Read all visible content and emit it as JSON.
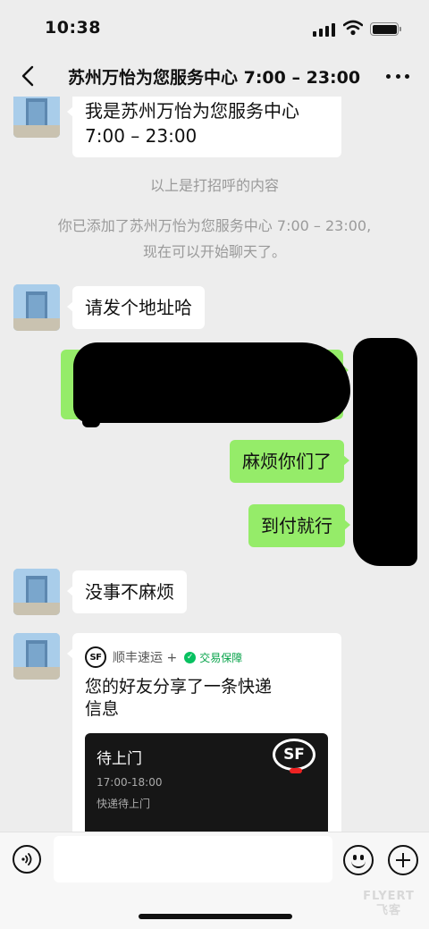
{
  "status_bar": {
    "time": "10:38"
  },
  "nav": {
    "title": "苏州万怡为您服务中心 7:00 – 23:00"
  },
  "messages": {
    "greeting_line1": "我是苏州万怡为您服务中心",
    "greeting_line2": "7:00 – 23:00",
    "system_greeting": "以上是打招呼的内容",
    "system_added_line1": "你已添加了苏州万怡为您服务中心 7:00 – 23:00,",
    "system_added_line2": "现在可以开始聊天了。",
    "ask_address": "请发个地址哈",
    "trouble": "麻烦你们了",
    "cod": "到付就行",
    "no_trouble": "没事不麻烦"
  },
  "card": {
    "brand": "顺丰速运 +",
    "guarantee": "交易保障",
    "text_line1": "您的好友分享了一条快递",
    "text_line2": "信息",
    "status": "待上门",
    "time_window": "17:00-18:00",
    "sub_status": "快递待上门",
    "logo_text": "SF"
  },
  "input": {
    "placeholder": ""
  },
  "watermark": {
    "line1": "FLYERT",
    "line2": "飞客"
  },
  "colors": {
    "background": "#ededed",
    "sent_bubble": "#95ec69",
    "received_bubble": "#ffffff"
  }
}
